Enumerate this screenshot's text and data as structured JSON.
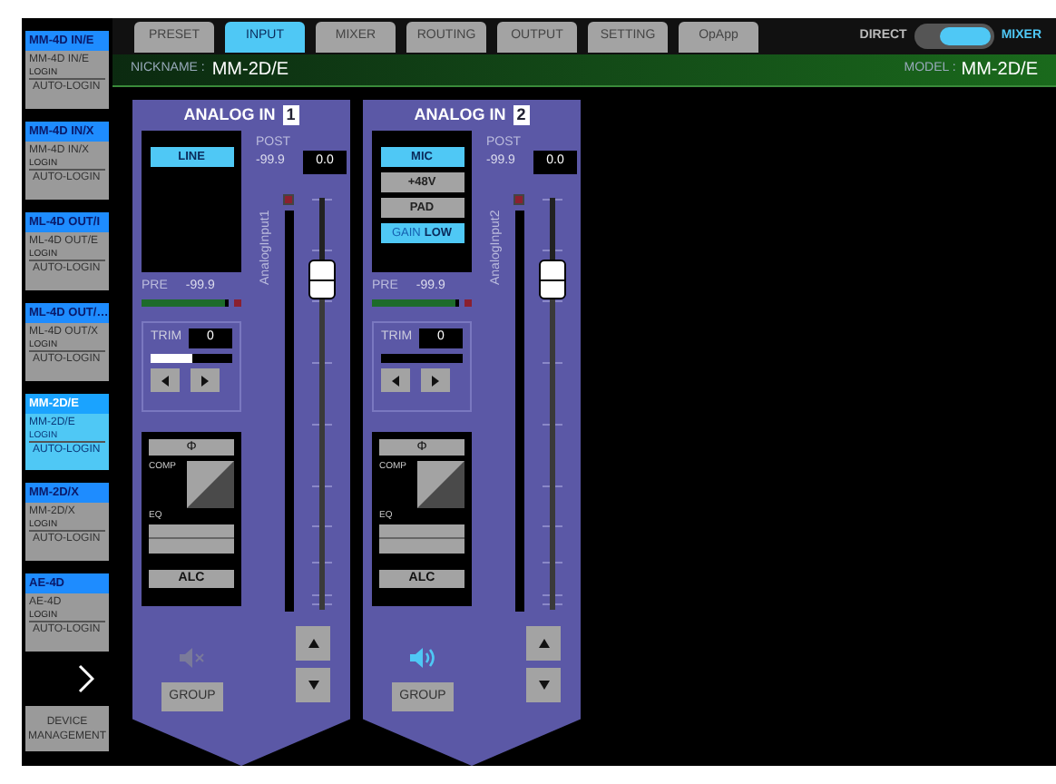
{
  "devices": [
    {
      "title": "MM-4D IN/E",
      "name": "MM-4D IN/E",
      "login": "LOGIN",
      "auto_login": "AUTO-LOGIN",
      "selected": false
    },
    {
      "title": "MM-4D IN/X",
      "name": "MM-4D IN/X",
      "login": "LOGIN",
      "auto_login": "AUTO-LOGIN",
      "selected": false
    },
    {
      "title": "ML-4D OUT/I",
      "name": "ML-4D OUT/E",
      "login": "LOGIN",
      "auto_login": "AUTO-LOGIN",
      "selected": false
    },
    {
      "title": "ML-4D OUT/…",
      "name": "ML-4D OUT/X",
      "login": "LOGIN",
      "auto_login": "AUTO-LOGIN",
      "selected": false
    },
    {
      "title": "MM-2D/E",
      "name": "MM-2D/E",
      "login": "LOGIN",
      "auto_login": "AUTO-LOGIN",
      "selected": true
    },
    {
      "title": "MM-2D/X",
      "name": "MM-2D/X",
      "login": "LOGIN",
      "auto_login": "AUTO-LOGIN",
      "selected": false
    },
    {
      "title": "AE-4D",
      "name": "AE-4D",
      "login": "LOGIN",
      "auto_login": "AUTO-LOGIN",
      "selected": false
    }
  ],
  "device_management": "DEVICE MANAGEMENT",
  "tabs": [
    {
      "label": "PRESET",
      "selected": false
    },
    {
      "label": "INPUT",
      "selected": true
    },
    {
      "label": "MIXER",
      "selected": false
    },
    {
      "label": "ROUTING",
      "selected": false
    },
    {
      "label": "OUTPUT",
      "selected": false
    },
    {
      "label": "SETTING",
      "selected": false
    },
    {
      "label": "OpApp",
      "selected": false
    }
  ],
  "mode_switch": {
    "left": "DIRECT",
    "right": "MIXER",
    "on": true
  },
  "nickname": {
    "label": "NICKNAME :",
    "value": "MM-2D/E"
  },
  "model": {
    "label": "MODEL :",
    "value": "MM-2D/E"
  },
  "channels": [
    {
      "title": "ANALOG IN",
      "number": "1",
      "buttons": [
        {
          "kind": "toggle",
          "label": "LINE",
          "on": true
        }
      ],
      "post_label": "POST",
      "post_reading": "-99.9",
      "post_value": "0.0",
      "name": "AnalogInput1",
      "pre_label": "PRE",
      "pre_reading": "-99.9",
      "pre_meter": {
        "level": 0.95
      },
      "trim_label": "TRIM",
      "trim_value": "0",
      "trim_bar": {
        "level": 0.5
      },
      "phase": "Φ",
      "comp": "COMP",
      "eq": "EQ",
      "alc": "ALC",
      "fader": {
        "level": 0.8
      },
      "muted": true,
      "group": "GROUP"
    },
    {
      "title": "ANALOG IN",
      "number": "2",
      "buttons": [
        {
          "kind": "toggle",
          "label": "MIC",
          "on": true
        },
        {
          "kind": "toggle",
          "label": "+48V",
          "on": false
        },
        {
          "kind": "toggle",
          "label": "PAD",
          "on": false
        },
        {
          "kind": "gain",
          "label": "GAIN",
          "value": "LOW",
          "on": true
        }
      ],
      "post_label": "POST",
      "post_reading": "-99.9",
      "post_value": "0.0",
      "name": "AnalogInput2",
      "pre_label": "PRE",
      "pre_reading": "-99.9",
      "pre_meter": {
        "level": 0.95
      },
      "trim_label": "TRIM",
      "trim_value": "0",
      "trim_bar": {
        "level": 0
      },
      "phase": "Φ",
      "comp": "COMP",
      "eq": "EQ",
      "alc": "ALC",
      "fader": {
        "level": 0.8
      },
      "muted": false,
      "group": "GROUP"
    }
  ]
}
